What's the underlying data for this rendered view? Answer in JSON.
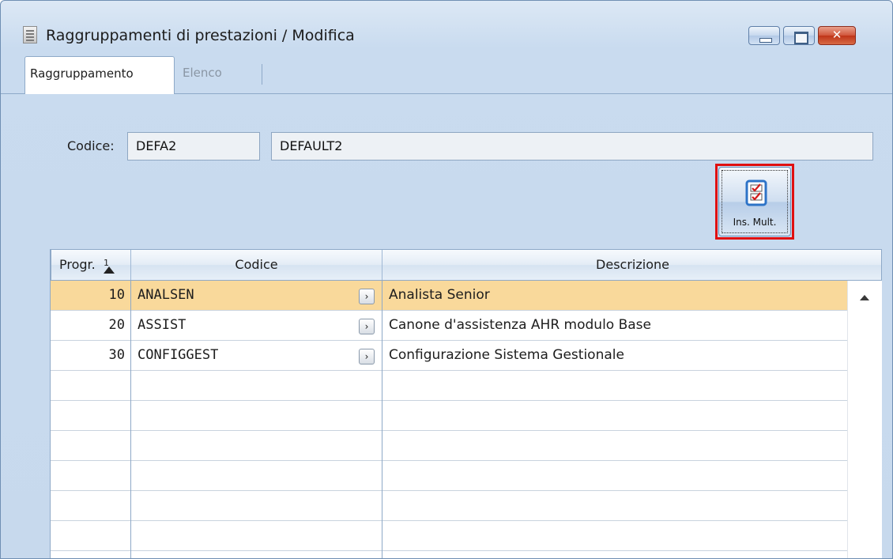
{
  "window": {
    "title": "Raggruppamenti di prestazioni / Modifica"
  },
  "tabs": [
    {
      "label": "Raggruppamento",
      "active": true
    },
    {
      "label": "Elenco",
      "active": false
    }
  ],
  "form": {
    "codice_label": "Codice:",
    "codice_value": "DEFA2",
    "descrizione_value": "DEFAULT2"
  },
  "toolbar": {
    "ins_mult_label": "Ins. Mult.",
    "ins_mult_icon": "checklist-icon",
    "highlight_color": "#e01010"
  },
  "grid": {
    "columns": [
      "Progr.",
      "Codice",
      "Descrizione"
    ],
    "sort_indicator": "1",
    "rows": [
      {
        "progr": "10",
        "codice": "ANALSEN",
        "descrizione": "Analista Senior",
        "selected": true
      },
      {
        "progr": "20",
        "codice": "ASSIST",
        "descrizione": "Canone d'assistenza AHR modulo Base",
        "selected": false
      },
      {
        "progr": "30",
        "codice": "CONFIGGEST",
        "descrizione": "Configurazione Sistema Gestionale",
        "selected": false
      }
    ],
    "selected_row_color": "#f9d99b"
  }
}
